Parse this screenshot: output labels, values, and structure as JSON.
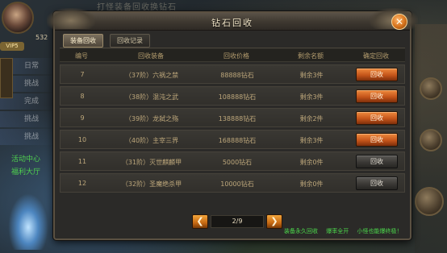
{
  "background": {
    "top_title": "打怪装备回收换钻石",
    "level_tag": "VIP5",
    "level_number": "532",
    "side_tabs": [
      "日常",
      "挑战",
      "完成",
      "挑战",
      "挑战"
    ],
    "green_lines": [
      "活动中心",
      "福利大厅"
    ]
  },
  "dialog": {
    "title": "钻石回收",
    "close_icon": "✕",
    "tabs": [
      {
        "label": "装备回收",
        "active": true
      },
      {
        "label": "回收记录",
        "active": false
      }
    ],
    "columns": [
      "编号",
      "回收装备",
      "回收价格",
      "剩余名额",
      "确定回收"
    ],
    "rows": [
      {
        "no": "7",
        "equip": "（37阶）六祸之禁",
        "price": "88888钻石",
        "left": "剩余3件",
        "action": "回收",
        "enabled": true
      },
      {
        "no": "8",
        "equip": "（38阶）混沌之武",
        "price": "108888钻石",
        "left": "剩余3件",
        "action": "回收",
        "enabled": true
      },
      {
        "no": "9",
        "equip": "（39阶）龙弑之殇",
        "price": "138888钻石",
        "left": "剩余2件",
        "action": "回收",
        "enabled": true
      },
      {
        "no": "10",
        "equip": "（40阶）主宰三界",
        "price": "168888钻石",
        "left": "剩余3件",
        "action": "回收",
        "enabled": true
      },
      {
        "no": "11",
        "equip": "（31阶）灭世麒麟甲",
        "price": "5000钻石",
        "left": "剩余0件",
        "action": "回收",
        "enabled": false
      },
      {
        "no": "12",
        "equip": "（32阶）圣魔绝杀甲",
        "price": "10000钻石",
        "left": "剩余0件",
        "action": "回收",
        "enabled": false
      }
    ],
    "pager": {
      "prev_icon": "❮",
      "next_icon": "❯",
      "display": "2/9"
    },
    "footer_notes": [
      "装备永久回收",
      "爆率全开",
      "小怪也能爆终极！"
    ]
  }
}
